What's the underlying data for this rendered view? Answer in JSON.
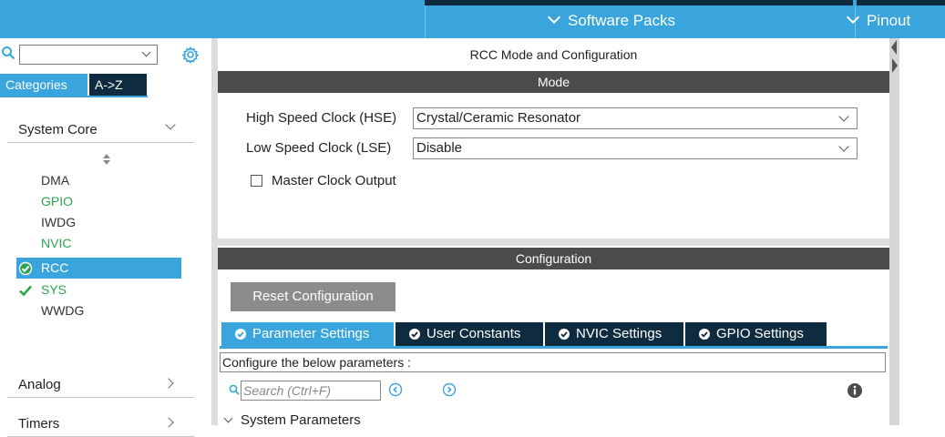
{
  "topbar": {
    "software_packs": "Software Packs",
    "pinout": "Pinout"
  },
  "sidebar": {
    "tabs": [
      "Categories",
      "A->Z"
    ],
    "groups": [
      {
        "label": "System Core",
        "expanded": true
      },
      {
        "label": "Analog",
        "expanded": false
      },
      {
        "label": "Timers",
        "expanded": false
      }
    ],
    "peripherals": [
      {
        "label": "DMA",
        "status": "none",
        "color": "#333333"
      },
      {
        "label": "GPIO",
        "status": "none",
        "color": "#2ea44f"
      },
      {
        "label": "IWDG",
        "status": "none",
        "color": "#333333"
      },
      {
        "label": "NVIC",
        "status": "none",
        "color": "#2ea44f"
      },
      {
        "label": "RCC",
        "status": "configured-selected",
        "color": "#ffffff"
      },
      {
        "label": "SYS",
        "status": "configured",
        "color": "#2ea44f"
      },
      {
        "label": "WWDG",
        "status": "none",
        "color": "#333333"
      }
    ]
  },
  "main": {
    "title": "RCC Mode and Configuration",
    "mode_header": "Mode",
    "hse_label": "High Speed Clock (HSE)",
    "hse_value": "Crystal/Ceramic Resonator",
    "lse_label": "Low Speed Clock (LSE)",
    "lse_value": "Disable",
    "mco_label": "Master Clock Output",
    "mco_checked": false,
    "config_header": "Configuration",
    "reset_button": "Reset Configuration",
    "config_tabs": [
      "Parameter Settings",
      "User Constants",
      "NVIC Settings",
      "GPIO Settings"
    ],
    "active_config_tab": "Parameter Settings",
    "params_note": "Configure the below parameters :",
    "search_placeholder": "Search (Ctrl+F)",
    "system_parameters": "System Parameters"
  },
  "colors": {
    "accent": "#39a5dc",
    "dark_navy": "#0f2b40",
    "section_header": "#4b4b4b",
    "ok_green": "#2ea44f"
  }
}
